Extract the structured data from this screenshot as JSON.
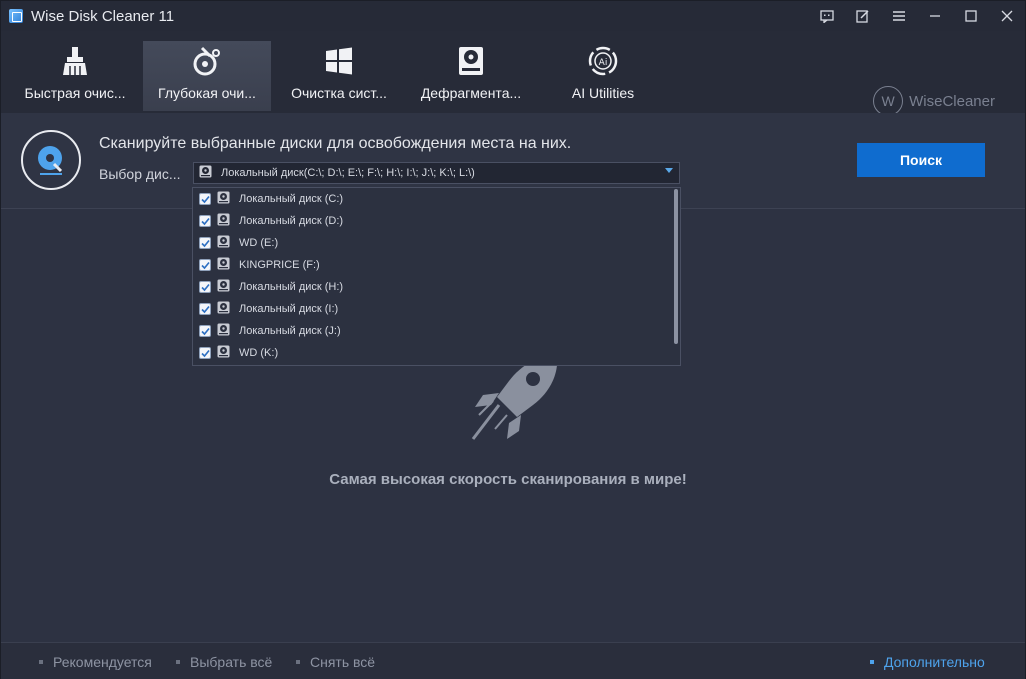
{
  "window": {
    "title": "Wise Disk Cleaner 11"
  },
  "tabs": [
    {
      "label": "Быстрая очис...",
      "icon": "broom-icon"
    },
    {
      "label": "Глубокая очи...",
      "icon": "deep-clean-icon"
    },
    {
      "label": "Очистка сист...",
      "icon": "windows-icon"
    },
    {
      "label": "Дефрагмента...",
      "icon": "disk-defrag-icon"
    },
    {
      "label": "AI Utilities",
      "icon": "ai-icon"
    }
  ],
  "brand": {
    "logo_letter": "W",
    "name": "WiseCleaner"
  },
  "header": {
    "title": "Сканируйте выбранные диски для освобождения места на них.",
    "drive_label": "Выбор дис...",
    "drive_value": "Локальный диск(C:\\; D:\\; E:\\; F:\\; H:\\; I:\\; J:\\; K:\\; L:\\)",
    "search_button": "Поиск"
  },
  "drives": [
    {
      "label": "Локальный диск (C:)",
      "checked": true
    },
    {
      "label": "Локальный диск (D:)",
      "checked": true
    },
    {
      "label": "WD (E:)",
      "checked": true
    },
    {
      "label": "KINGPRICE (F:)",
      "checked": true
    },
    {
      "label": "Локальный диск (H:)",
      "checked": true
    },
    {
      "label": "Локальный диск (I:)",
      "checked": true
    },
    {
      "label": "Локальный диск (J:)",
      "checked": true
    },
    {
      "label": "WD (K:)",
      "checked": true
    }
  ],
  "main": {
    "message": "Самая высокая скорость сканирования в мире!"
  },
  "footer": {
    "recommended": "Рекомендуется",
    "select_all": "Выбрать всё",
    "deselect_all": "Снять всё",
    "more": "Дополнительно"
  },
  "colors": {
    "accent": "#0f6ccf",
    "link": "#4ea3ec",
    "background": "#2d3242"
  }
}
